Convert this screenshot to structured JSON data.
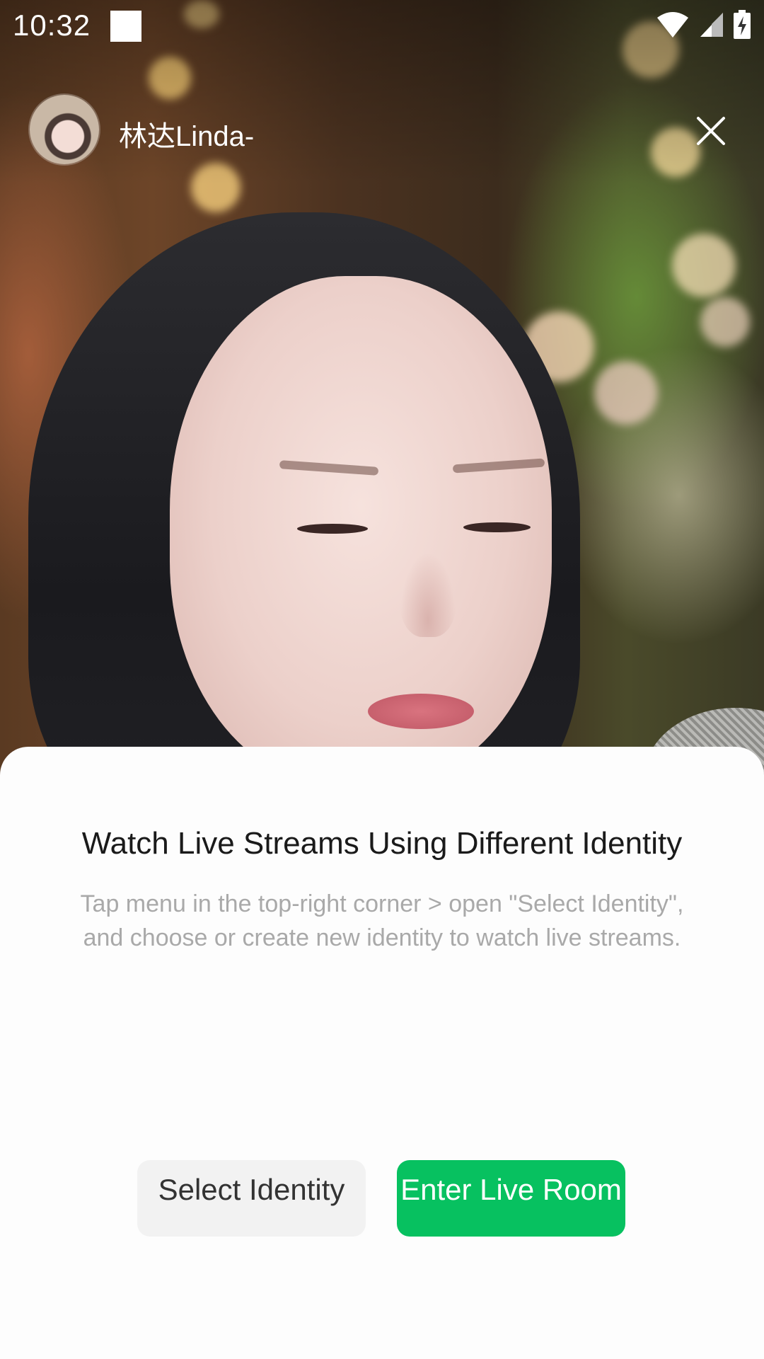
{
  "status_bar": {
    "time": "10:32",
    "icons": [
      "notification-square-icon",
      "wifi-icon",
      "cellular-signal-icon",
      "battery-charging-icon"
    ]
  },
  "stream": {
    "streamer_name": "林达Linda-",
    "close_icon": "close-icon"
  },
  "sheet": {
    "title": "Watch Live Streams Using Different Identity",
    "description": "Tap menu in the top-right corner > open \"Select Identity\", and choose or create new identity to watch live streams.",
    "buttons": {
      "select_identity": "Select Identity",
      "enter_live_room": "Enter Live Room"
    }
  },
  "colors": {
    "accent_green": "#07c160",
    "secondary_button": "#f2f2f2",
    "title_text": "#1a1a1a",
    "desc_text": "#a9a9a9",
    "sheet_bg": "#fdfdfd"
  }
}
